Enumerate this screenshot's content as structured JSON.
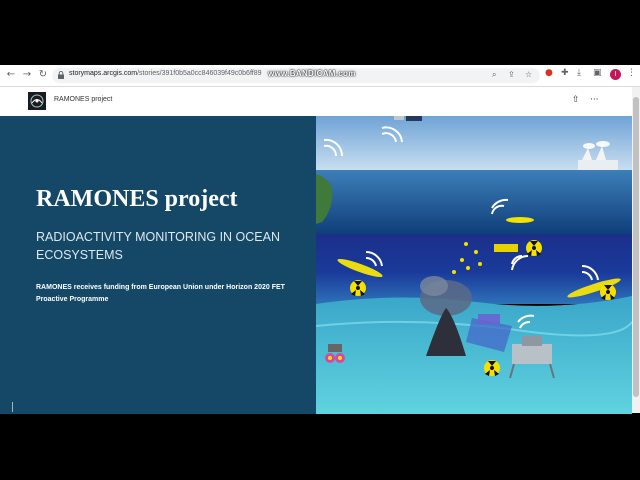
{
  "browser": {
    "url_host": "storymaps.arcgis.com",
    "url_path": "/stories/391f0b5a0cc846039f49c0b6ff89",
    "avatar_letter": "I",
    "icons": [
      "back-icon",
      "forward-icon",
      "reload-icon",
      "lock-icon",
      "zoom-icon",
      "share-icon",
      "star-icon",
      "extension-shield-icon",
      "extensions-puzzle-icon",
      "download-icon",
      "sidebar-icon",
      "menu-kebab-icon"
    ]
  },
  "watermark": "www.BANDICAM.com",
  "storymap": {
    "header_title": "RAMONES project",
    "icons": [
      "share-icon",
      "more-icon"
    ]
  },
  "cover": {
    "title": "RAMONES project",
    "subtitle": "RADIOACTIVITY MONITORING IN OCEAN ECOSYSTEMS",
    "funding": "RAMONES receives funding from European Union under Horizon 2020 FET Proactive Programme",
    "panel_color": "#144866"
  },
  "hero_image": {
    "icons": [
      "radiation-icon",
      "wifi-signal-icon",
      "underwater-glider-icon",
      "satellite-icon",
      "hydrothermal-vent",
      "seafloor-lander",
      "nuclear-plant"
    ],
    "colors": {
      "sky": "#8fb8de",
      "sea_surface": "#1a5c97",
      "deep": "#0d1f6b",
      "seafloor": "#4fc3d6",
      "radiation": "#f5e000"
    }
  }
}
